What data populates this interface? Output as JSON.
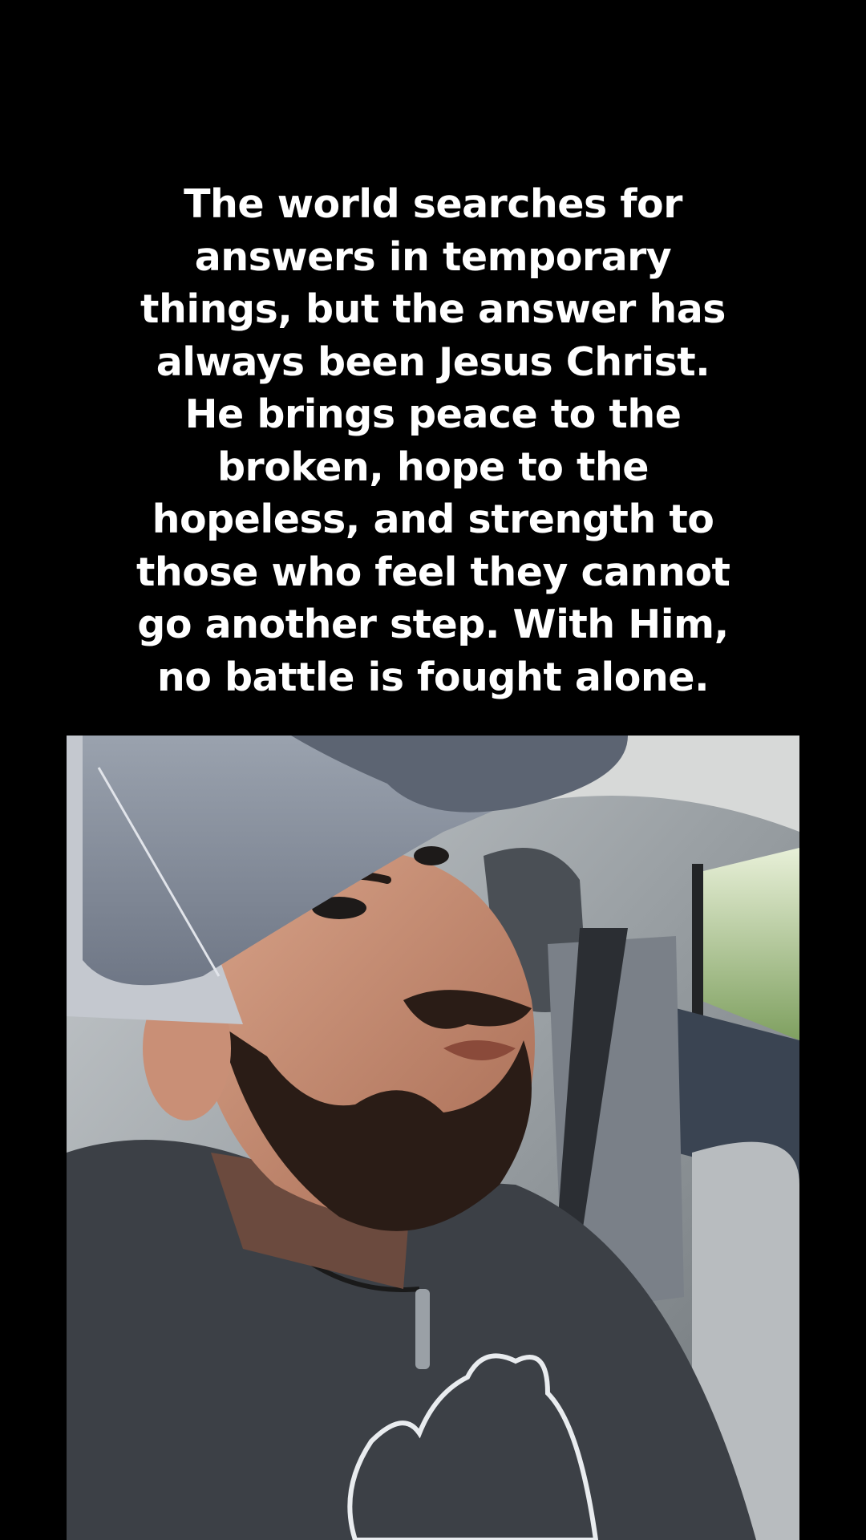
{
  "caption": {
    "lines": [
      "The world searches for",
      "answers in temporary",
      "things, but the answer has",
      "always been Jesus Christ.",
      "He brings peace to the",
      "broken, hope to the",
      "hopeless, and strength to",
      "those who feel they cannot",
      "go another step. With Him,",
      "no battle is fought alone."
    ]
  },
  "video": {
    "subject": "man-in-car-video-frame"
  },
  "colors": {
    "background": "#000000",
    "caption_text": "#ffffff"
  }
}
